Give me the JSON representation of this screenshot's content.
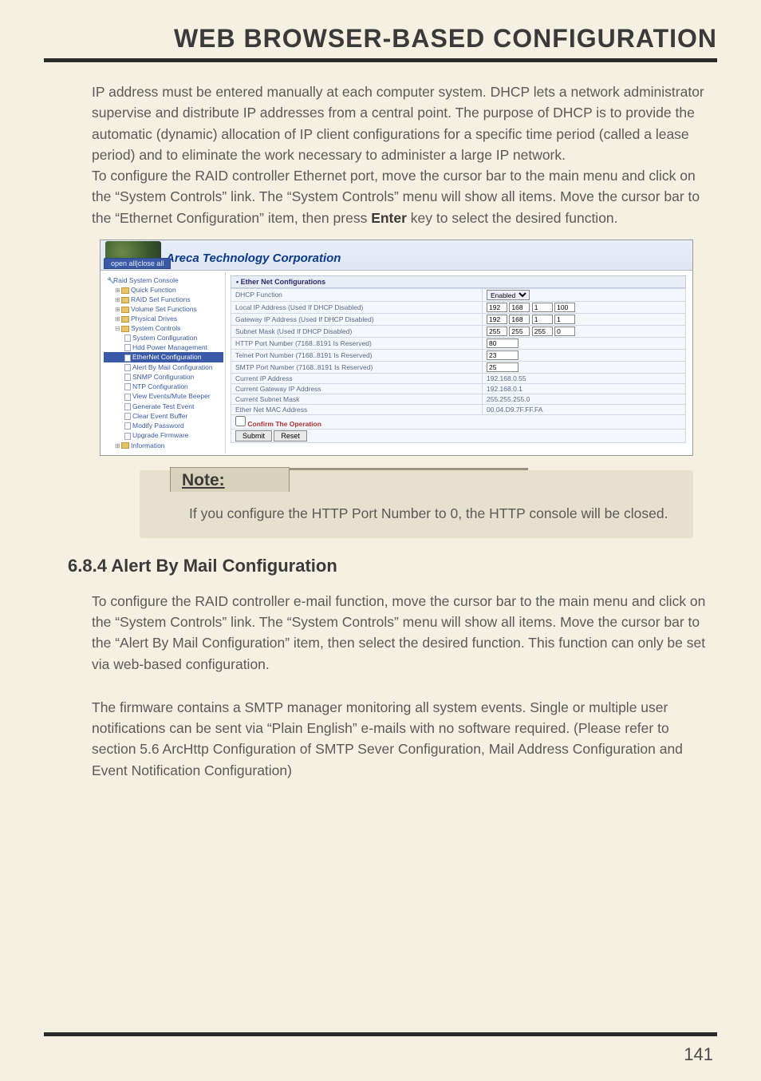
{
  "title": "WEB BROWSER-BASED CONFIGURATION",
  "para1_a": "IP address must be entered manually at each computer system. DHCP lets a network administrator supervise and distribute IP addresses from a central point. The purpose of DHCP is to provide the automatic (dynamic) allocation of IP client configurations for a specific time period (called a lease period) and to eliminate the work necessary to administer a large IP network.",
  "para1_b_pre": "To configure the RAID controller Ethernet port, move the cursor bar to the main menu and click on the “System Controls” link. The “System Controls” menu will show all items. Move the cursor bar to the “Ethernet Configuration” item, then press ",
  "para1_b_bold": "Enter",
  "para1_b_post": " key to select the desired function.",
  "ui": {
    "brand": "Areca Technology Corporation",
    "openclose": "open all|close all",
    "nav": {
      "root": "Raid System Console",
      "quick": "Quick Function",
      "raidset": "RAID Set Functions",
      "volset": "Volume Set Functions",
      "phys": "Physical Drives",
      "sysctl": "System Controls",
      "syscfg": "System Configuration",
      "hdd": "Hdd Power Management",
      "ethcfg": "EtherNet Configuration",
      "alert": "Alert By Mail Configuration",
      "snmp": "SNMP Configuration",
      "ntp": "NTP Configuration",
      "viewev": "View Events/Mute Beeper",
      "gentest": "Generate Test Event",
      "clearbuf": "Clear Event Buffer",
      "modpw": "Modify Password",
      "upgrade": "Upgrade Firmware",
      "info": "Information"
    },
    "cfg_title": "• Ether Net Configurations",
    "rows": {
      "dhcp_label": "DHCP Function",
      "dhcp_value": "Enabled",
      "local_label": "Local IP Address (Used If DHCP Disabled)",
      "local_ip": [
        "192",
        "168",
        "1",
        "100"
      ],
      "gw_label": "Gateway IP Address (Used If DHCP Disabled)",
      "gw_ip": [
        "192",
        "168",
        "1",
        "1"
      ],
      "mask_label": "Subnet Mask (Used If DHCP Disabled)",
      "mask_ip": [
        "255",
        "255",
        "255",
        "0"
      ],
      "http_label": "HTTP Port Number (7168..8191 Is Reserved)",
      "http_val": "80",
      "telnet_label": "Telnet Port Number (7168..8191 Is Reserved)",
      "telnet_val": "23",
      "smtp_label": "SMTP Port Number (7168..8191 Is Reserved)",
      "smtp_val": "25",
      "curip_label": "Current IP Address",
      "curip_val": "192.168.0.55",
      "curgw_label": "Current Gateway IP Address",
      "curgw_val": "192.168.0.1",
      "cursub_label": "Current Subnet Mask",
      "cursub_val": "255.255.255.0",
      "mac_label": "Ether Net MAC Address",
      "mac_val": "00.04.D9.7F.FF.FA"
    },
    "confirm": "Confirm The Operation",
    "submit": "Submit",
    "reset": "Reset"
  },
  "note_title": "Note:",
  "note_body": "If you configure the HTTP Port Number to 0, the HTTP console will be closed.",
  "section_head": "6.8.4 Alert By Mail Configuration",
  "para2": "To configure the RAID controller e-mail function, move the cursor bar to the main menu and click on the “System Controls” link. The “System Controls” menu will show all items. Move the cursor bar to the “Alert By Mail Configuration” item, then select the desired function. This function can only be set via web-based configuration.",
  "para3": "The firmware contains a SMTP manager monitoring all system events. Single or multiple user notifications can be sent via “Plain English” e-mails with no software required. (Please refer to section 5.6 ArcHttp Configuration of SMTP Sever Configuration, Mail Address Configuration and Event Notification Configuration)",
  "page_number": "141"
}
